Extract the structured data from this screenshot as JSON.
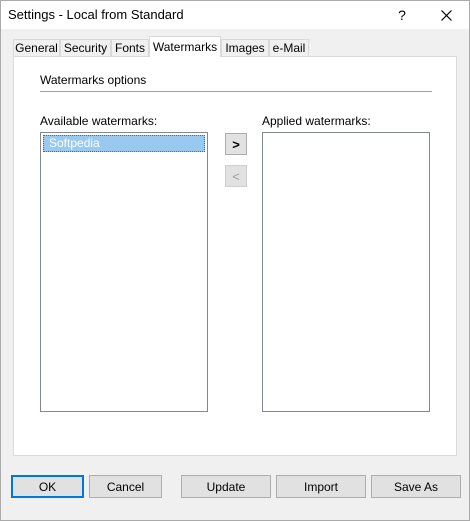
{
  "window": {
    "title": "Settings - Local from Standard",
    "help_label": "?"
  },
  "tabs": [
    {
      "label": "General",
      "active": false
    },
    {
      "label": "Security",
      "active": false
    },
    {
      "label": "Fonts",
      "active": false
    },
    {
      "label": "Watermarks",
      "active": true
    },
    {
      "label": "Images",
      "active": false
    },
    {
      "label": "e-Mail",
      "active": false
    }
  ],
  "watermarks": {
    "section_label": "Watermarks options",
    "available_label": "Available watermarks:",
    "applied_label": "Applied watermarks:",
    "available_items": [
      "Softpedia"
    ],
    "applied_items": [],
    "add_label": ">",
    "remove_label": "<"
  },
  "buttons": {
    "ok": "OK",
    "cancel": "Cancel",
    "update": "Update",
    "import": "Import",
    "save_as": "Save As"
  },
  "colors": {
    "selection": "#99c9ef",
    "default_button_border": "#0078d7"
  }
}
